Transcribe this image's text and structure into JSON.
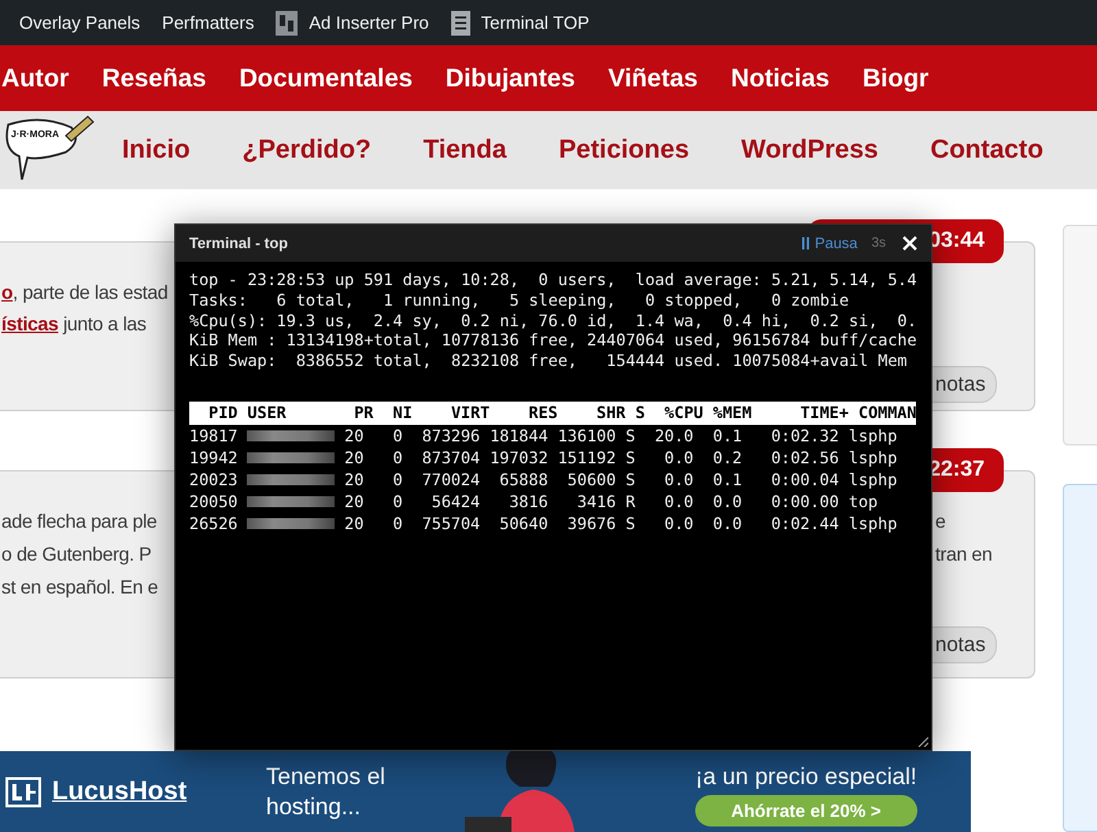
{
  "admin_bar": {
    "items": [
      {
        "label": "Overlay Panels",
        "kind": "plain"
      },
      {
        "label": "Perfmatters",
        "kind": "plain"
      },
      {
        "label": "Ad Inserter Pro",
        "kind": "plugin"
      },
      {
        "label": "Terminal TOP",
        "kind": "document"
      }
    ]
  },
  "main_nav": {
    "items": [
      "Autor",
      "Reseñas",
      "Documentales",
      "Dibujantes",
      "Viñetas",
      "Noticias",
      "Biogr"
    ]
  },
  "sub_nav": {
    "logo_text": "J·R·MORA",
    "items": [
      "Inicio",
      "¿Perdido?",
      "Tienda",
      "Peticiones",
      "WordPress",
      "Contacto"
    ]
  },
  "posts": [
    {
      "time": "03:44",
      "left_lines": [
        {
          "link": "o",
          "text": ", parte de las estad"
        },
        {
          "link": "ísticas",
          "text": " junto a las"
        }
      ],
      "button": "notas"
    },
    {
      "time": "22:37",
      "left_lines": [
        {
          "text": "ade flecha para ple"
        },
        {
          "text": "o de Gutenberg. P"
        },
        {
          "text": "st en español. En e"
        }
      ],
      "right_lines": [
        "e",
        "tran en"
      ],
      "button": "notas"
    }
  ],
  "banner": {
    "brand": "LucusHost",
    "headline": "Tenemos el hosting...",
    "tagline": "¡a un precio especial!",
    "cta": "Ahórrate el 20% >"
  },
  "terminal": {
    "title": "Terminal - top",
    "pause_label": "Pausa",
    "interval": "3s",
    "summary_lines": [
      "top - 23:28:53 up 591 days, 10:28,  0 users,  load average: 5.21, 5.14, 5.4",
      "Tasks:   6 total,   1 running,   5 sleeping,   0 stopped,   0 zombie",
      "%Cpu(s): 19.3 us,  2.4 sy,  0.2 ni, 76.0 id,  1.4 wa,  0.4 hi,  0.2 si,  0.",
      "KiB Mem : 13134198+total, 10778136 free, 24407064 used, 96156784 buff/cache",
      "KiB Swap:  8386552 total,  8232108 free,   154444 used. 10075084+avail Mem"
    ],
    "columns": [
      "PID",
      "USER",
      "PR",
      "NI",
      "VIRT",
      "RES",
      "SHR",
      "S",
      "%CPU",
      "%MEM",
      "TIME+",
      "COMMAN"
    ],
    "rows": [
      {
        "pid": "19817",
        "pr": "20",
        "ni": "0",
        "virt": "873296",
        "res": "181844",
        "shr": "136100",
        "s": "S",
        "cpu": "20.0",
        "mem": "0.1",
        "time": "0:02.32",
        "command": "lsphp"
      },
      {
        "pid": "19942",
        "pr": "20",
        "ni": "0",
        "virt": "873704",
        "res": "197032",
        "shr": "151192",
        "s": "S",
        "cpu": "0.0",
        "mem": "0.2",
        "time": "0:02.56",
        "command": "lsphp"
      },
      {
        "pid": "20023",
        "pr": "20",
        "ni": "0",
        "virt": "770024",
        "res": "65888",
        "shr": "50600",
        "s": "S",
        "cpu": "0.0",
        "mem": "0.1",
        "time": "0:00.04",
        "command": "lsphp"
      },
      {
        "pid": "20050",
        "pr": "20",
        "ni": "0",
        "virt": "56424",
        "res": "3816",
        "shr": "3416",
        "s": "R",
        "cpu": "0.0",
        "mem": "0.0",
        "time": "0:00.00",
        "command": "top"
      },
      {
        "pid": "26526",
        "pr": "20",
        "ni": "0",
        "virt": "755704",
        "res": "50640",
        "shr": "39676",
        "s": "S",
        "cpu": "0.0",
        "mem": "0.0",
        "time": "0:02.44",
        "command": "lsphp"
      }
    ]
  }
}
